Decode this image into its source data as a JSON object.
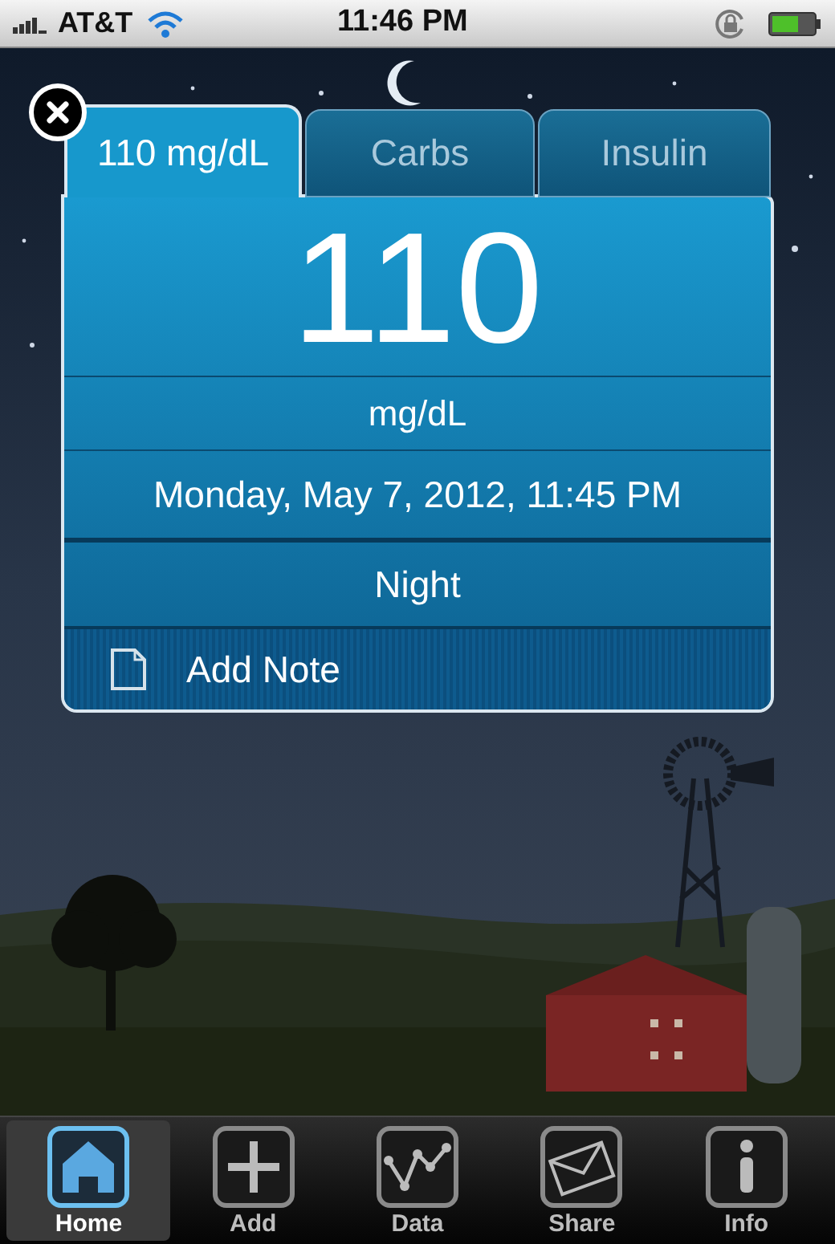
{
  "status_bar": {
    "carrier": "AT&T",
    "time": "11:46 PM"
  },
  "tabs": [
    {
      "label": "110 mg/dL",
      "selected": true
    },
    {
      "label": "Carbs",
      "selected": false
    },
    {
      "label": "Insulin",
      "selected": false
    }
  ],
  "reading": {
    "value": "110",
    "unit": "mg/dL",
    "datetime": "Monday, May 7, 2012, 11:45 PM",
    "period": "Night",
    "note_action": "Add Note"
  },
  "tab_bar": [
    {
      "kind": "home",
      "label": "Home",
      "selected": true
    },
    {
      "kind": "add",
      "label": "Add",
      "selected": false
    },
    {
      "kind": "data",
      "label": "Data",
      "selected": false
    },
    {
      "kind": "share",
      "label": "Share",
      "selected": false
    },
    {
      "kind": "info",
      "label": "Info",
      "selected": false
    }
  ]
}
